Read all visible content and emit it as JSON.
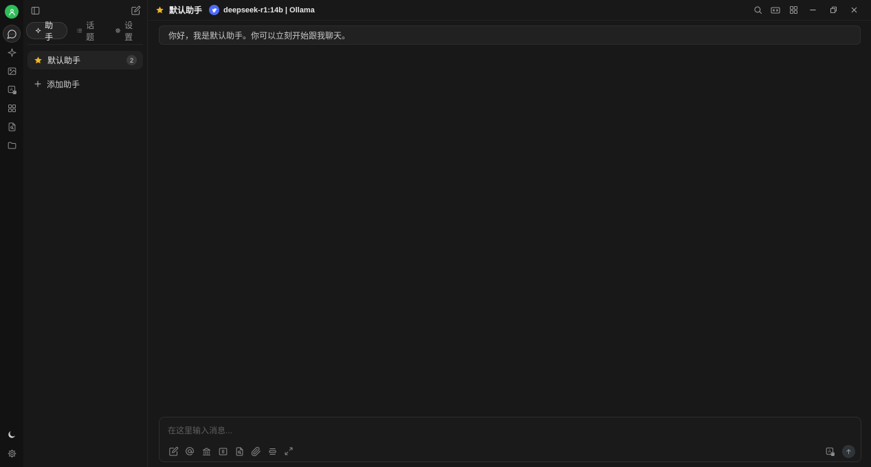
{
  "colors": {
    "avatar_green": "#2ebd59",
    "deepseek_blue": "#4d6bfe",
    "star_gold": "#f2b824",
    "panel_bg": "#181818",
    "send_disabled": "#2f3439"
  },
  "rail": {
    "icons": [
      {
        "name": "user-avatar"
      },
      {
        "name": "chat-icon",
        "active": true
      },
      {
        "name": "sparkle-agents-icon"
      },
      {
        "name": "image-paintings-icon"
      },
      {
        "name": "translate-icon"
      },
      {
        "name": "apps-grid-icon"
      },
      {
        "name": "knowledge-file-search-icon"
      },
      {
        "name": "folder-files-icon"
      }
    ],
    "bottom_icons": [
      {
        "name": "moon-theme-icon"
      },
      {
        "name": "settings-gear-icon"
      }
    ]
  },
  "sidebar": {
    "header_icons": [
      "panel-collapse-icon",
      "new-topic-icon"
    ],
    "tabs": [
      {
        "label": "助手",
        "icon": "sparkle-icon"
      },
      {
        "label": "话题",
        "icon": "list-icon"
      },
      {
        "label": "设置",
        "icon": "gear-icon"
      }
    ],
    "assistants": [
      {
        "name": "默认助手",
        "badge": "2",
        "icon": "star-icon"
      }
    ],
    "add_assistant_label": "添加助手"
  },
  "topbar": {
    "assistant_name": "默认助手",
    "assistant_icon": "star-icon",
    "model_label": "deepseek-r1:14b | Ollama",
    "model_logo": "deepseek-logo",
    "right_icons": [
      "search-icon",
      "expand-horizontal-icon",
      "launcher-grid-icon"
    ],
    "window_controls": [
      "minimize-button",
      "restore-button",
      "close-button"
    ]
  },
  "chat": {
    "greeting": "你好，我是默认助手。你可以立刻开始跟我聊天。"
  },
  "input": {
    "placeholder": "在这里输入消息...",
    "toolbar_icons": [
      "new-topic-icon",
      "mention-icon",
      "landmark-icon",
      "columns-panel-icon",
      "file-search-icon",
      "paperclip-icon",
      "clear-context-icon",
      "expand-input-icon"
    ],
    "right_icons": [
      "translate-icon",
      "send-button"
    ]
  }
}
